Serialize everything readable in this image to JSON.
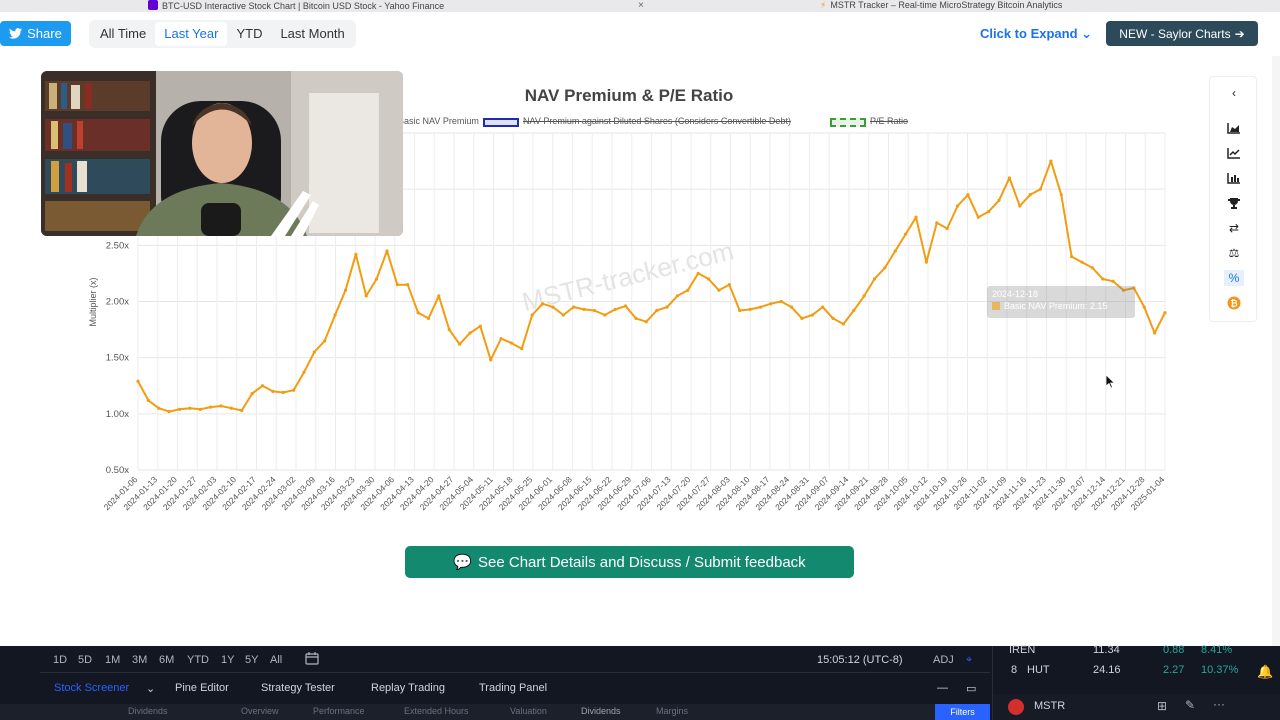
{
  "browser": {
    "tabs": [
      {
        "title": "BTC-USD Interactive Stock Chart | Bitcoin USD Stock - Yahoo Finance",
        "icon": "yahoo-icon",
        "color": "#6001d2"
      },
      {
        "title": "MSTR Tracker – Real-time MicroStrategy Bitcoin Analytics",
        "icon": "lightning-icon",
        "color": "#f7931a"
      }
    ]
  },
  "toolbar": {
    "share_label": "Share",
    "ranges": [
      "All Time",
      "Last Year",
      "YTD",
      "Last Month"
    ],
    "active_range": "Last Year",
    "expand_label": "Click to Expand",
    "saylor_label": "NEW - Saylor Charts"
  },
  "chart_data": {
    "type": "line",
    "title": "NAV Premium & P/E Ratio",
    "ylabel": "Multiplier (x)",
    "xlabel": "",
    "ylim": [
      0.5,
      3.5
    ],
    "y_ticks": [
      "0.50x",
      "1.00x",
      "1.50x",
      "2.00x",
      "2.50x"
    ],
    "legend": [
      {
        "name": "Basic NAV Premium",
        "color": "#f39c12",
        "hidden": false
      },
      {
        "name": "NAV Premium against Diluted Shares (Considers Convertible Debt)",
        "color": "#1f2bb0",
        "hidden": true
      },
      {
        "name": "P/E Ratio",
        "color": "#3a9d3a",
        "hidden": true
      }
    ],
    "x_ticks": [
      "2024-01-06",
      "2024-01-13",
      "2024-01-20",
      "2024-01-27",
      "2024-02-03",
      "2024-02-10",
      "2024-02-17",
      "2024-02-24",
      "2024-03-02",
      "2024-03-09",
      "2024-03-16",
      "2024-03-23",
      "2024-03-30",
      "2024-04-06",
      "2024-04-13",
      "2024-04-20",
      "2024-04-27",
      "2024-05-04",
      "2024-05-11",
      "2024-05-18",
      "2024-05-25",
      "2024-06-01",
      "2024-06-08",
      "2024-06-15",
      "2024-06-22",
      "2024-06-29",
      "2024-07-06",
      "2024-07-13",
      "2024-07-20",
      "2024-07-27",
      "2024-08-03",
      "2024-08-10",
      "2024-08-17",
      "2024-08-24",
      "2024-08-31",
      "2024-09-07",
      "2024-09-14",
      "2024-09-21",
      "2024-09-28",
      "2024-10-05",
      "2024-10-12",
      "2024-10-19",
      "2024-10-26",
      "2024-11-02",
      "2024-11-09",
      "2024-11-16",
      "2024-11-23",
      "2024-11-30",
      "2024-12-07",
      "2024-12-14",
      "2024-12-21",
      "2024-12-28",
      "2025-01-04"
    ],
    "series": [
      {
        "name": "Basic NAV Premium",
        "color": "#f39c12",
        "values": [
          1.29,
          1.12,
          1.05,
          1.02,
          1.04,
          1.05,
          1.04,
          1.06,
          1.07,
          1.05,
          1.03,
          1.18,
          1.25,
          1.2,
          1.19,
          1.21,
          1.37,
          1.55,
          1.65,
          1.88,
          2.1,
          2.42,
          2.05,
          2.2,
          2.45,
          2.15,
          2.15,
          1.9,
          1.85,
          2.05,
          1.75,
          1.62,
          1.72,
          1.78,
          1.48,
          1.67,
          1.63,
          1.58,
          1.88,
          1.98,
          1.95,
          1.88,
          1.95,
          1.93,
          1.92,
          1.88,
          1.93,
          1.96,
          1.85,
          1.82,
          1.92,
          1.95,
          2.05,
          2.1,
          2.25,
          2.2,
          2.1,
          2.15,
          1.92,
          1.93,
          1.95,
          1.98,
          2.0,
          1.95,
          1.85,
          1.88,
          1.95,
          1.85,
          1.8,
          1.92,
          2.05,
          2.2,
          2.3,
          2.45,
          2.6,
          2.75,
          2.35,
          2.7,
          2.65,
          2.85,
          2.95,
          2.75,
          2.8,
          2.9,
          3.1,
          2.85,
          2.95,
          3.0,
          3.25,
          2.95,
          2.4,
          2.35,
          2.3,
          2.2,
          2.18,
          2.1,
          2.12,
          1.95,
          1.72,
          1.9
        ]
      }
    ]
  },
  "watermark": "MSTR-tracker.com",
  "tooltip": {
    "date": "2024-12-18",
    "label": "Basic NAV Premium: 2.15"
  },
  "details_button": "See Chart Details and Discuss / Submit feedback",
  "side_icons": [
    "chevron-left-icon",
    "area-chart-icon",
    "line-chart-icon",
    "bar-chart-icon",
    "trophy-icon",
    "swap-icon",
    "scale-icon",
    "percent-icon",
    "bitcoin-icon"
  ],
  "trading": {
    "timeframes": [
      "1D",
      "5D",
      "1M",
      "3M",
      "6M",
      "YTD",
      "1Y",
      "5Y",
      "All"
    ],
    "time": "15:05:12 (UTC-8)",
    "adj": "ADJ",
    "tabs": [
      "Stock Screener",
      "Pine Editor",
      "Strategy Tester",
      "Replay Trading",
      "Trading Panel"
    ],
    "tickers": [
      {
        "symbol": "IREN",
        "price": "11.34",
        "change": "0.88",
        "pct": "8.41%"
      },
      {
        "symbol": "HUT",
        "price": "24.16",
        "change": "2.27",
        "pct": "10.37%"
      }
    ],
    "symbol": "MSTR",
    "bottom_tabs": [
      "Dividends",
      "Overview",
      "Performance",
      "Extended Hours",
      "Valuation",
      "Dividends",
      "Margins"
    ],
    "filters_label": "Filters"
  }
}
